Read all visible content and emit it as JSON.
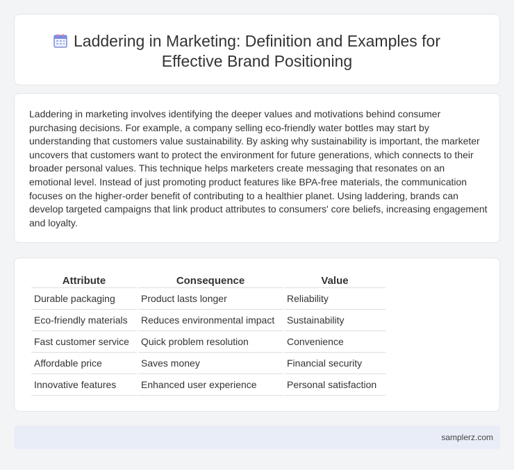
{
  "header": {
    "title_line1": "Laddering in Marketing: Definition and Examples for",
    "title_line2": "Effective Brand Positioning",
    "icon": "calendar-icon",
    "icon_color": "#7b8ce0"
  },
  "description": "Laddering in marketing involves identifying the deeper values and motivations behind consumer purchasing decisions. For example, a company selling eco-friendly water bottles may start by understanding that customers value sustainability. By asking why sustainability is important, the marketer uncovers that customers want to protect the environment for future generations, which connects to their broader personal values. This technique helps marketers create messaging that resonates on an emotional level. Instead of just promoting product features like BPA-free materials, the communication focuses on the higher-order benefit of contributing to a healthier planet. Using laddering, brands can develop targeted campaigns that link product attributes to consumers' core beliefs, increasing engagement and loyalty.",
  "table": {
    "headers": [
      "Attribute",
      "Consequence",
      "Value"
    ],
    "rows": [
      [
        "Durable packaging",
        "Product lasts longer",
        "Reliability"
      ],
      [
        "Eco-friendly materials",
        "Reduces environmental impact",
        "Sustainability"
      ],
      [
        "Fast customer service",
        "Quick problem resolution",
        "Convenience"
      ],
      [
        "Affordable price",
        "Saves money",
        "Financial security"
      ],
      [
        "Innovative features",
        "Enhanced user experience",
        "Personal satisfaction"
      ]
    ]
  },
  "footer": {
    "site": "samplerz.com"
  }
}
